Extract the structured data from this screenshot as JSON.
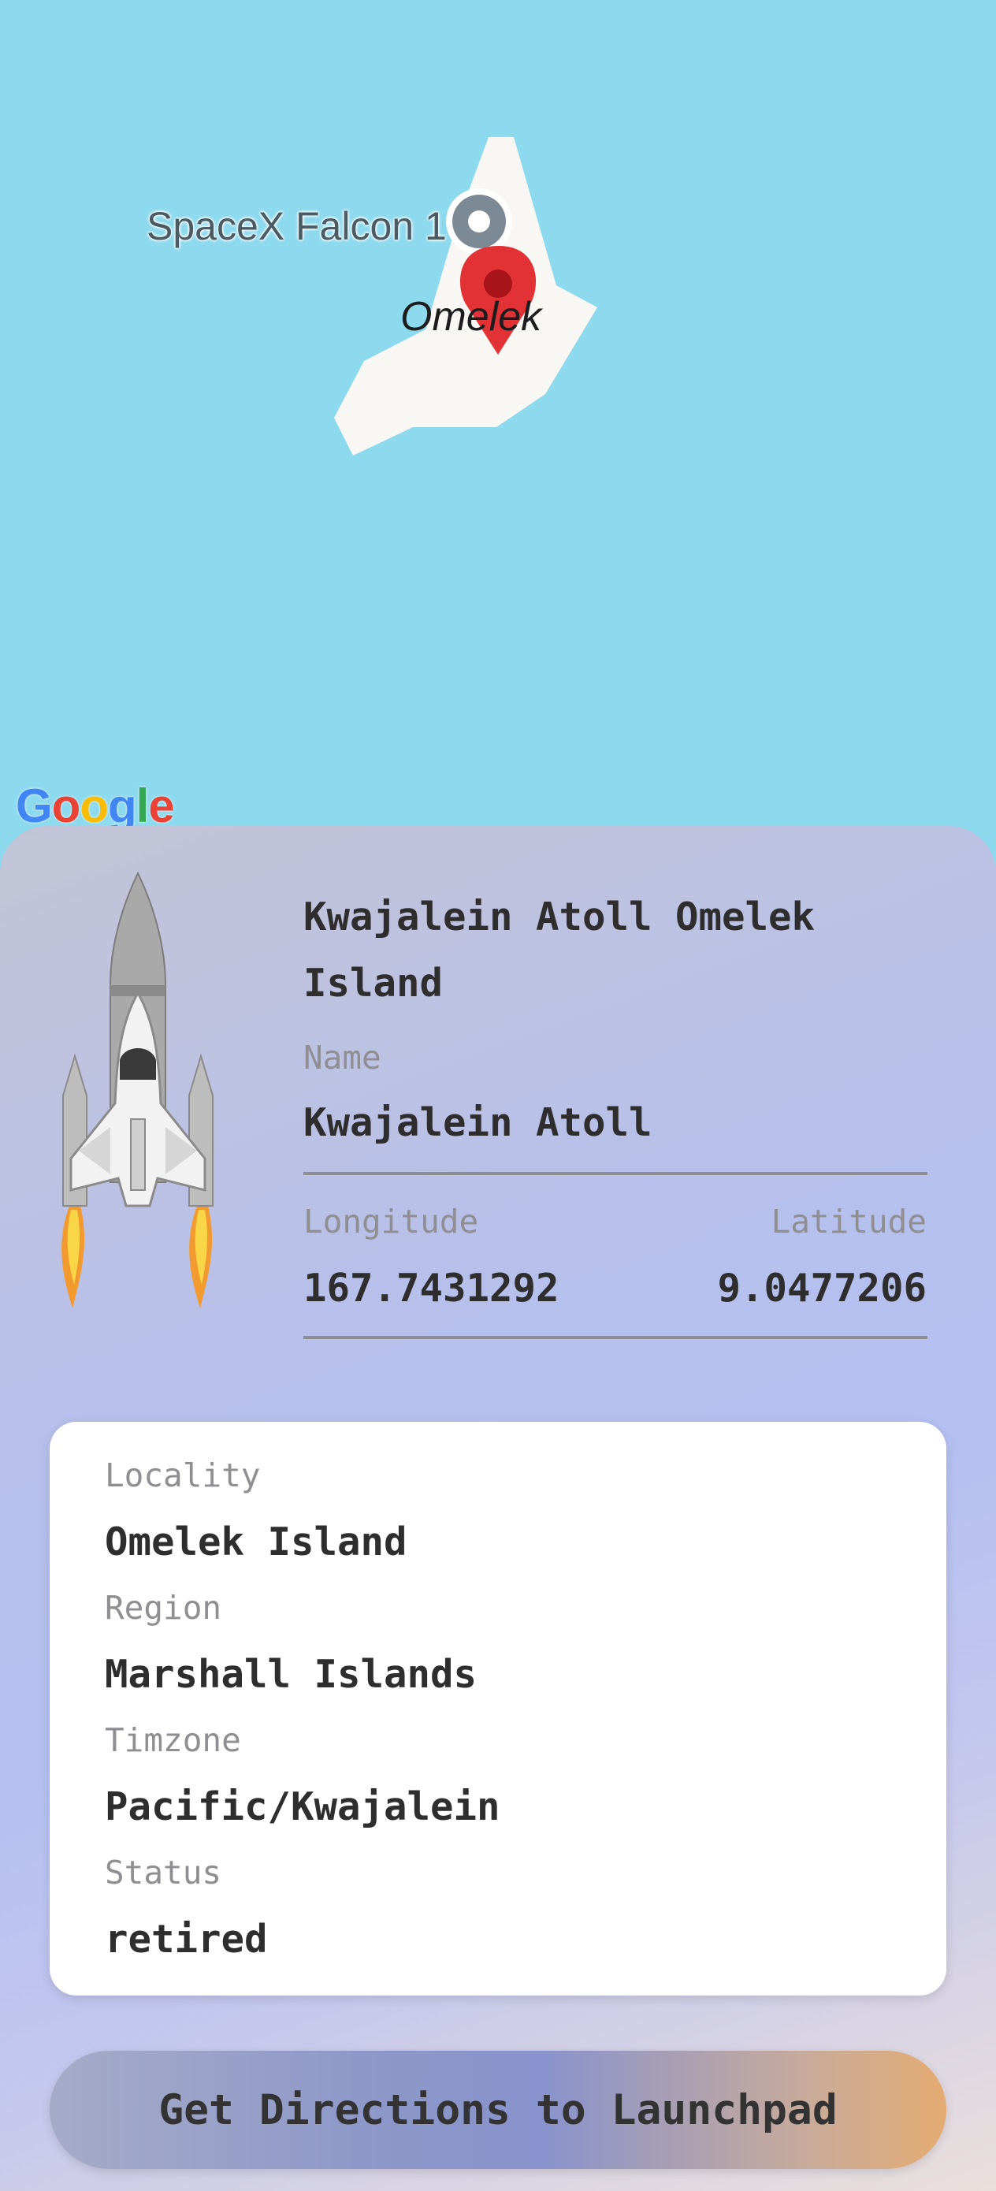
{
  "map": {
    "poi_label": "SpaceX Falcon 1",
    "island_label": "Omelek",
    "attribution": "Google",
    "colors": {
      "water": "#8dd9ed",
      "land": "#f8f7f3",
      "pin": "#e33236"
    }
  },
  "launchpad": {
    "title": "Kwajalein Atoll Omelek Island",
    "name_label": "Name",
    "name_value": "Kwajalein Atoll",
    "longitude_label": "Longitude",
    "longitude_value": "167.7431292",
    "latitude_label": "Latitude",
    "latitude_value": "9.0477206"
  },
  "details": {
    "locality_label": "Locality",
    "locality_value": "Omelek Island",
    "region_label": "Region",
    "region_value": "Marshall Islands",
    "timezone_label": "Timzone",
    "timezone_value": "Pacific/Kwajalein",
    "status_label": "Status",
    "status_value": "retired"
  },
  "actions": {
    "directions_label": "Get Directions to Launchpad"
  }
}
